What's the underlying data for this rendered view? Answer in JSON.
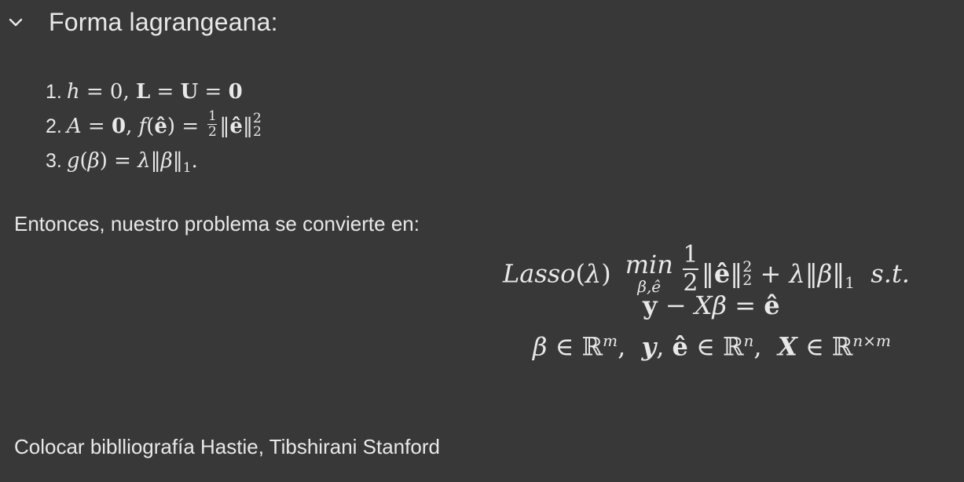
{
  "header": {
    "title": "Forma lagrangeana:"
  },
  "list": {
    "items": [
      {
        "num": "1.",
        "formula": "h = 0, L = U = 0"
      },
      {
        "num": "2.",
        "formula": "A = 0, f(ê) = 1/2 ||ê||_2^2"
      },
      {
        "num": "3.",
        "formula": "g(β) = λ||β||_1."
      }
    ]
  },
  "intro_text": "Entonces, nuestro problema se convierte en:",
  "display": {
    "line1": "Lasso(λ) min_{β,ê} 1/2 ||ê||_2^2 + λ||β||_1 s.t.",
    "line2": "y − Xβ = ê",
    "line3": "β ∈ ℝ^m, y, ê ∈ ℝ^n, X ∈ ℝ^{n×m}"
  },
  "footer_text": "Colocar biblliografía Hastie, Tibshirani Stanford"
}
